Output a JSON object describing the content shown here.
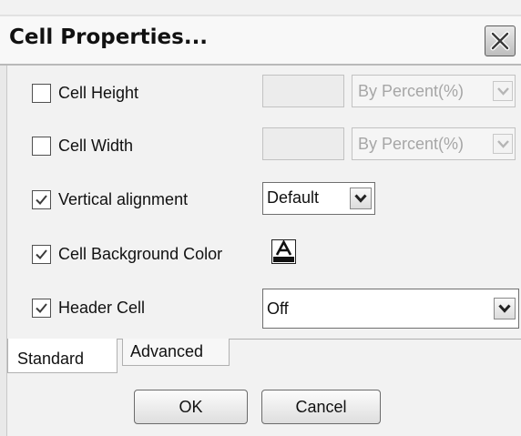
{
  "dialog": {
    "title": "Cell Properties...",
    "close_icon": "close-x-icon"
  },
  "rows": {
    "cell_height": {
      "label": "Cell Height",
      "checked": false,
      "value": "",
      "unit": "By Percent(%)"
    },
    "cell_width": {
      "label": "Cell Width",
      "checked": false,
      "value": "",
      "unit": "By Percent(%)"
    },
    "vertical_alignment": {
      "label": "Vertical alignment",
      "checked": true,
      "selected": "Default"
    },
    "cell_background_color": {
      "label": "Cell Background Color",
      "checked": true,
      "icon": "text-color-a-icon"
    },
    "header_cell": {
      "label": "Header Cell",
      "checked": true,
      "selected": "Off"
    }
  },
  "tabs": {
    "standard": "Standard",
    "advanced": "Advanced"
  },
  "buttons": {
    "ok": "OK",
    "cancel": "Cancel"
  }
}
